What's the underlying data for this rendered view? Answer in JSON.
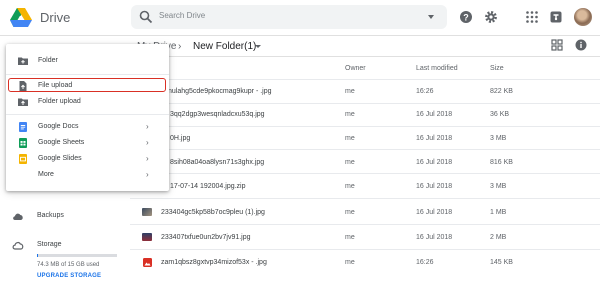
{
  "header": {
    "app_title": "Drive",
    "search_placeholder": "Search Drive",
    "icons": [
      "help-icon",
      "settings-icon",
      "apps-icon",
      "notifications-icon"
    ]
  },
  "breadcrumb": {
    "root": "My Drive",
    "separator": "›",
    "current": "New Folder(1)"
  },
  "columns": {
    "owner": "Owner",
    "last_modified": "Last modified",
    "size": "Size"
  },
  "files": [
    {
      "name": "nulahg5cde9pkocmag9kupr - .jpg",
      "owner": "me",
      "modified": "16:26",
      "size": "822 KB",
      "type": "image"
    },
    {
      "name": "3qq2dgp3wesqnladcxu53q.jpg",
      "owner": "me",
      "modified": "16 Jul 2018",
      "size": "36 KB",
      "type": "image"
    },
    {
      "name": "0H.jpg",
      "owner": "me",
      "modified": "16 Jul 2018",
      "size": "3 MB",
      "type": "image"
    },
    {
      "name": "8sih08a04oa8lysn71s3ghx.jpg",
      "owner": "me",
      "modified": "16 Jul 2018",
      "size": "816 KB",
      "type": "image"
    },
    {
      "name": "17-07-14 192004.jpg.zip",
      "owner": "me",
      "modified": "16 Jul 2018",
      "size": "3 MB",
      "type": "zip"
    },
    {
      "name": "233404gc5kp58b7oc9pleu (1).jpg",
      "owner": "me",
      "modified": "16 Jul 2018",
      "size": "1 MB",
      "type": "image"
    },
    {
      "name": "233407txfue0un2bv7jv91.jpg",
      "owner": "me",
      "modified": "16 Jul 2018",
      "size": "2 MB",
      "type": "image"
    },
    {
      "name": "zam1qbsz8gxtvp34mizof53x - .jpg",
      "owner": "me",
      "modified": "16:26",
      "size": "145 KB",
      "type": "image-red"
    }
  ],
  "sidebar": {
    "backups": "Backups",
    "storage": "Storage",
    "storage_used_text": "74.3 MB of 15 GB used",
    "storage_used_fraction": 0.005,
    "upgrade": "UPGRADE STORAGE"
  },
  "new_menu": {
    "items": [
      {
        "label": "Folder",
        "icon": "folder-add-icon"
      },
      {
        "label": "File upload",
        "icon": "file-upload-icon",
        "highlighted": true
      },
      {
        "label": "Folder upload",
        "icon": "folder-upload-icon"
      },
      {
        "label": "Google Docs",
        "icon": "google-docs-icon",
        "submenu": true
      },
      {
        "label": "Google Sheets",
        "icon": "google-sheets-icon",
        "submenu": true
      },
      {
        "label": "Google Slides",
        "icon": "google-slides-icon",
        "submenu": true
      },
      {
        "label": "More",
        "icon": "",
        "submenu": true
      }
    ],
    "submenu_arrow": "›"
  },
  "colors": {
    "accent": "#1a73e8",
    "highlight_border": "#d93025",
    "docs": "#4285f4",
    "sheets": "#0f9d58",
    "slides": "#f4b400"
  }
}
